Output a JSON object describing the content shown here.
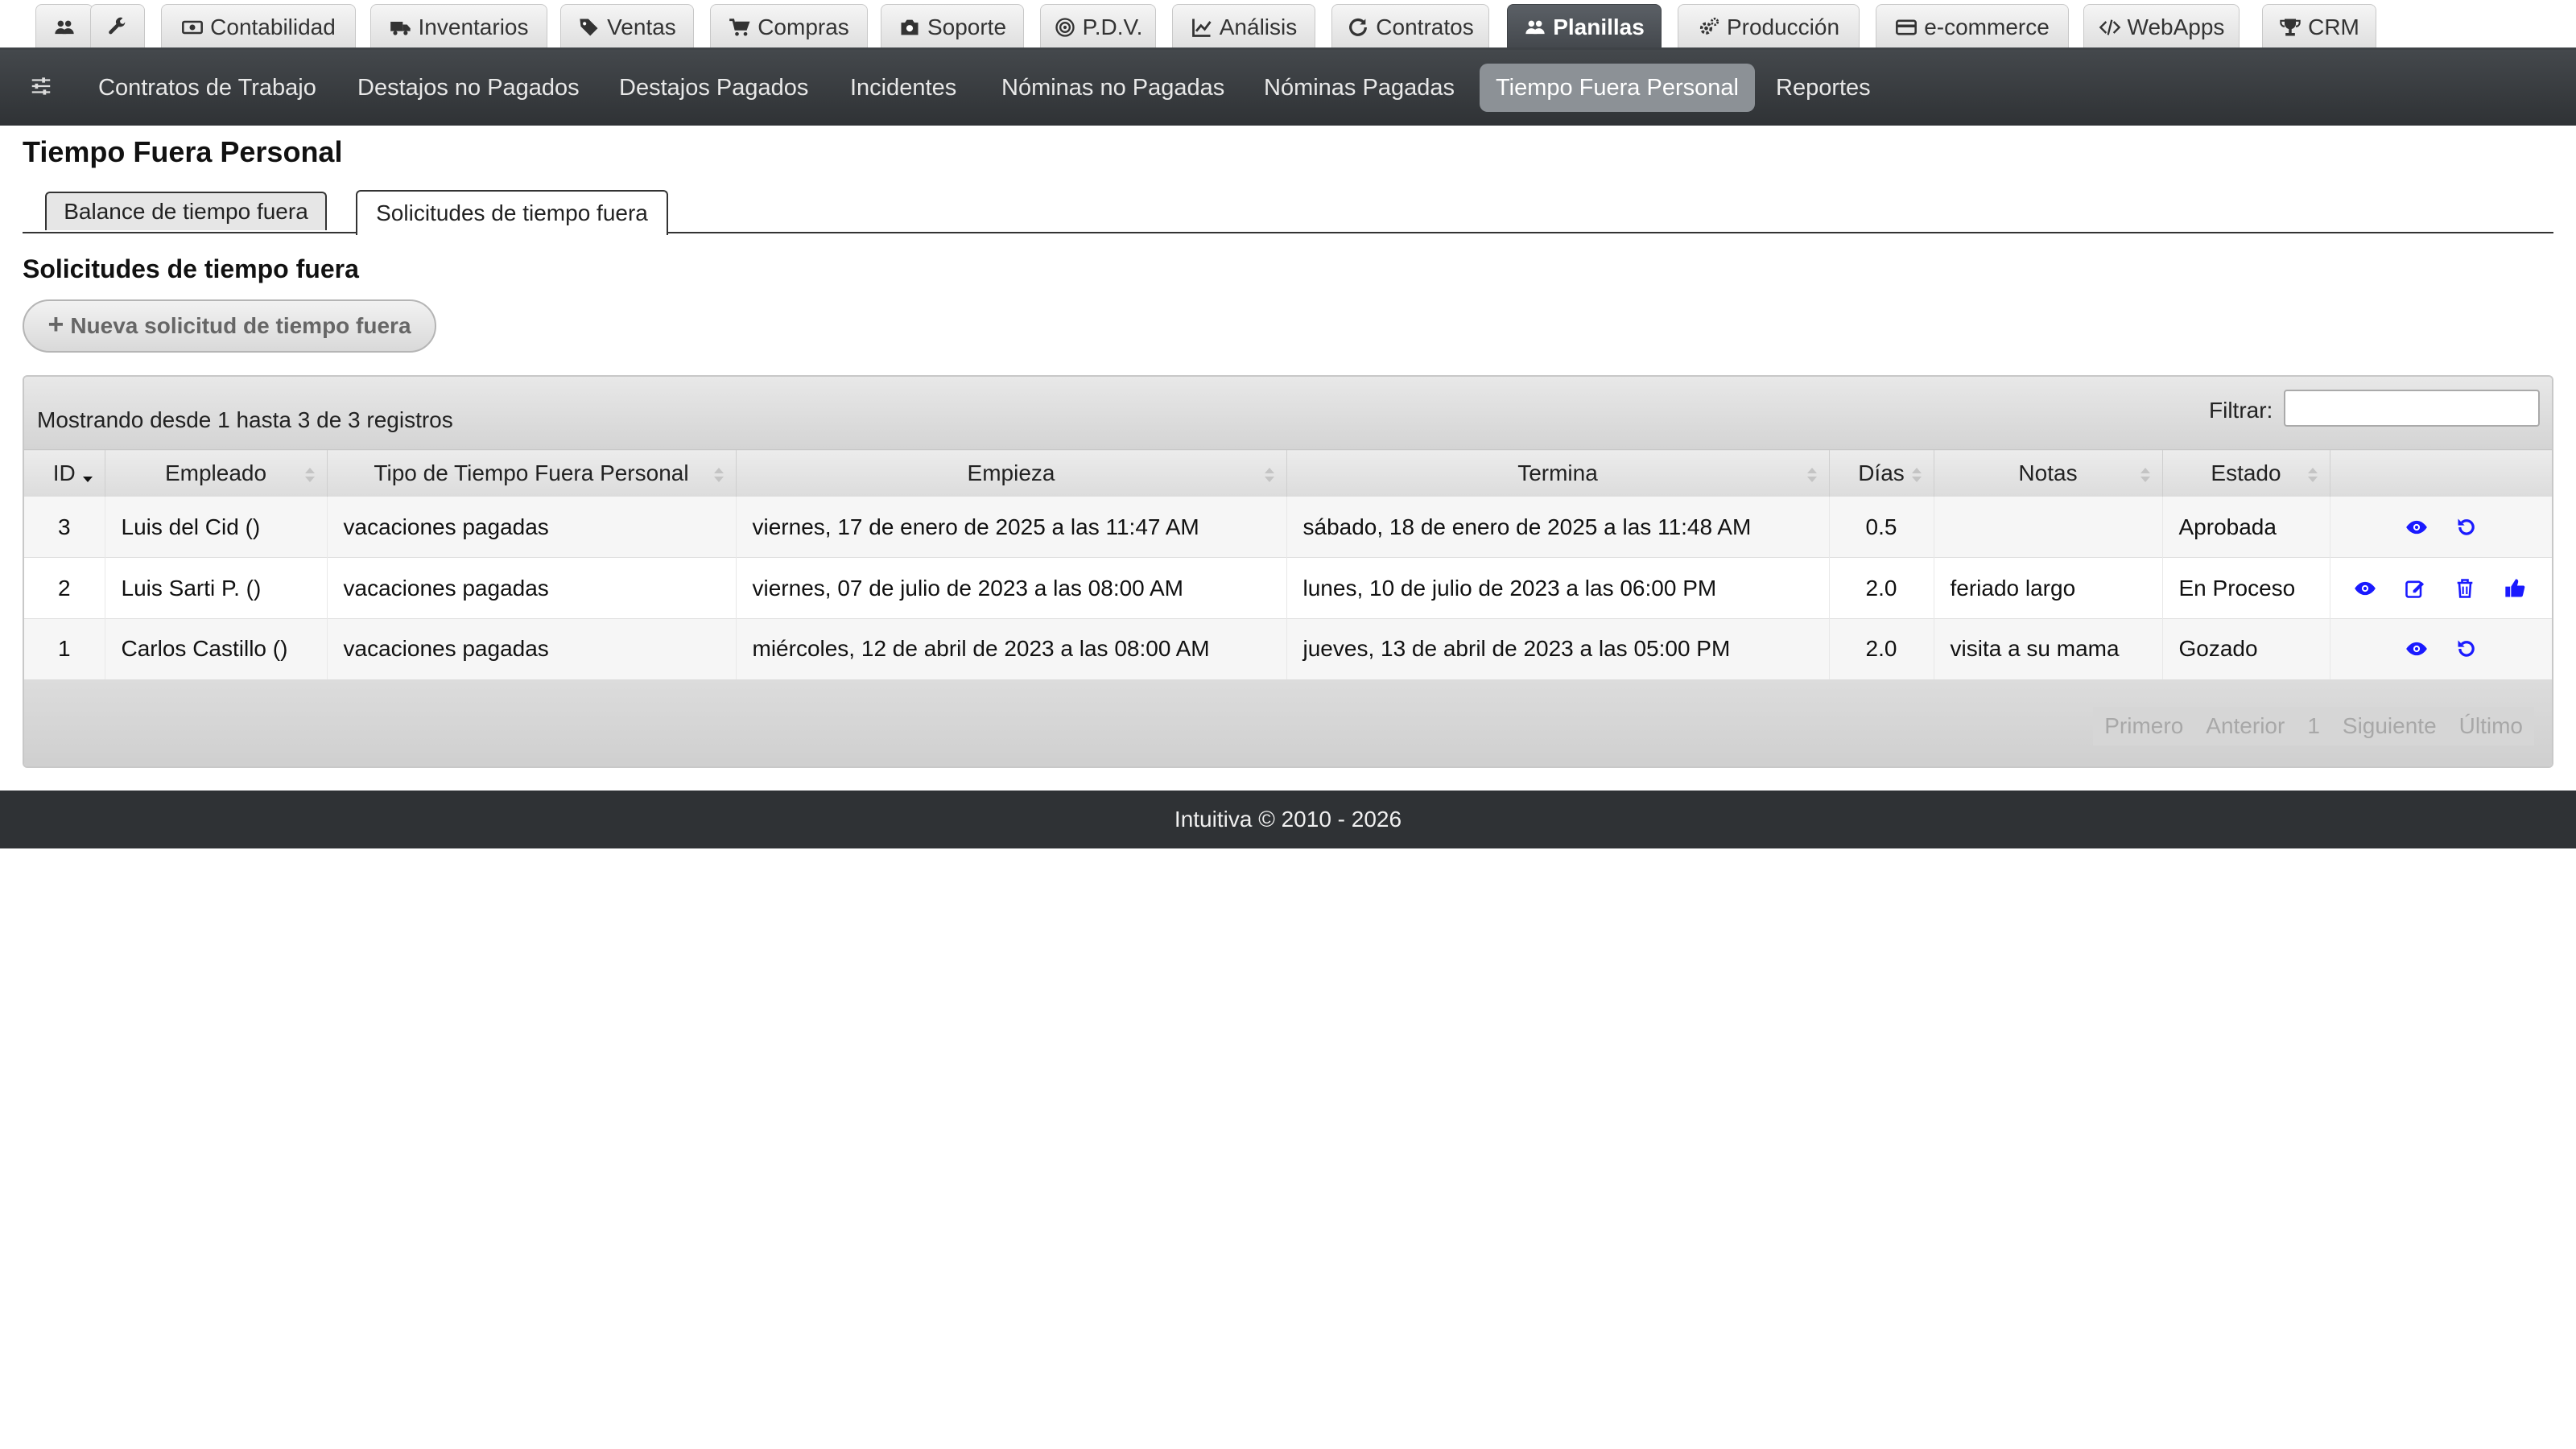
{
  "top_tabs": [
    {
      "label": "",
      "icon": "users-icon",
      "active": false
    },
    {
      "label": "",
      "icon": "wrench-icon",
      "active": false
    },
    {
      "label": "Contabilidad",
      "icon": "money-icon",
      "active": false
    },
    {
      "label": "Inventarios",
      "icon": "truck-icon",
      "active": false
    },
    {
      "label": "Ventas",
      "icon": "tags-icon",
      "active": false
    },
    {
      "label": "Compras",
      "icon": "cart-icon",
      "active": false
    },
    {
      "label": "Soporte",
      "icon": "camera-icon",
      "active": false
    },
    {
      "label": "P.D.V.",
      "icon": "target-icon",
      "active": false
    },
    {
      "label": "Análisis",
      "icon": "chart-line-icon",
      "active": false
    },
    {
      "label": "Contratos",
      "icon": "refresh-icon",
      "active": false
    },
    {
      "label": "Planillas",
      "icon": "users-icon",
      "active": true
    },
    {
      "label": "Producción",
      "icon": "gears-icon",
      "active": false
    },
    {
      "label": "e-commerce",
      "icon": "credit-card-icon",
      "active": false
    },
    {
      "label": "WebApps",
      "icon": "code-icon",
      "active": false
    },
    {
      "label": "CRM",
      "icon": "trophy-icon",
      "active": false
    }
  ],
  "subnav": {
    "icon": "sliders-icon",
    "items": [
      {
        "label": "Contratos de Trabajo",
        "active": false
      },
      {
        "label": "Destajos no Pagados",
        "active": false
      },
      {
        "label": "Destajos Pagados",
        "active": false
      },
      {
        "label": "Incidentes",
        "active": false
      },
      {
        "label": "Nóminas no Pagadas",
        "active": false
      },
      {
        "label": "Nóminas Pagadas",
        "active": false
      },
      {
        "label": "Tiempo Fuera Personal",
        "active": true
      },
      {
        "label": "Reportes",
        "active": false
      }
    ]
  },
  "page": {
    "title": "Tiempo Fuera Personal",
    "tabs": [
      {
        "label": "Balance de tiempo fuera",
        "active": false
      },
      {
        "label": "Solicitudes de tiempo fuera",
        "active": true
      }
    ],
    "section_title": "Solicitudes de tiempo fuera",
    "new_button": {
      "icon": "+",
      "label": "Nueva solicitud de tiempo fuera"
    }
  },
  "table": {
    "info": "Mostrando desde 1 hasta 3 de 3 registros",
    "filter_label": "Filtrar:",
    "filter_value": "",
    "columns": [
      "ID",
      "Empleado",
      "Tipo de Tiempo Fuera Personal",
      "Empieza",
      "Termina",
      "Días",
      "Notas",
      "Estado",
      ""
    ],
    "rows": [
      {
        "id": "3",
        "empleado": "Luis del Cid ()",
        "tipo": "vacaciones pagadas",
        "empieza": "viernes, 17 de enero de 2025 a las 11:47 AM",
        "termina": "sábado, 18 de enero de 2025 a las 11:48 AM",
        "dias": "0.5",
        "notas": "",
        "estado": "Aprobada",
        "actions": [
          "eye-icon",
          "undo-icon"
        ]
      },
      {
        "id": "2",
        "empleado": "Luis Sarti P. ()",
        "tipo": "vacaciones pagadas",
        "empieza": "viernes, 07 de julio de 2023 a las 08:00 AM",
        "termina": "lunes, 10 de julio de 2023 a las 06:00 PM",
        "dias": "2.0",
        "notas": "feriado largo",
        "estado": "En Proceso",
        "actions": [
          "eye-icon",
          "edit-icon",
          "trash-icon",
          "thumbs-up-icon"
        ]
      },
      {
        "id": "1",
        "empleado": "Carlos Castillo ()",
        "tipo": "vacaciones pagadas",
        "empieza": "miércoles, 12 de abril de 2023 a las 08:00 AM",
        "termina": "jueves, 13 de abril de 2023 a las 05:00 PM",
        "dias": "2.0",
        "notas": "visita a su mama",
        "estado": "Gozado",
        "actions": [
          "eye-icon",
          "undo-icon"
        ]
      }
    ],
    "pagination": [
      "Primero",
      "Anterior",
      "1",
      "Siguiente",
      "Último"
    ]
  },
  "footer": {
    "text": "Intuitiva © 2010 - 2026"
  },
  "colors": {
    "nav_dark": "#2f3235",
    "active_tab": "#4f5459",
    "subnav_active": "#8c9196",
    "action_icon": "#1a1aff"
  }
}
